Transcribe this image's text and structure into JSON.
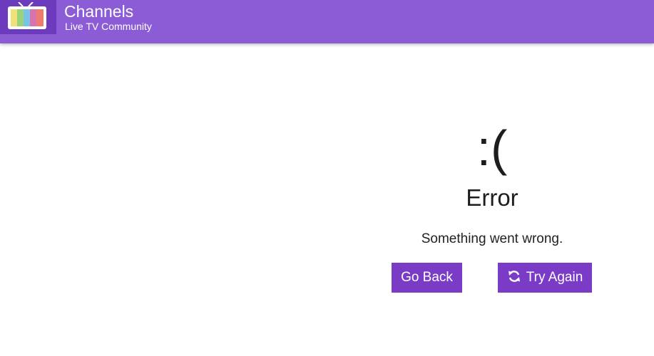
{
  "header": {
    "title": "Channels",
    "subtitle": "Live TV Community",
    "logo_icon": "tv-icon",
    "colors": {
      "bar": "#8b5cd6",
      "logo_bg": "#6c3bbd"
    }
  },
  "error": {
    "face": ":(",
    "title": "Error",
    "message": "Something went wrong."
  },
  "actions": {
    "go_back_label": "Go Back",
    "try_again_label": "Try Again",
    "try_again_icon": "refresh-icon",
    "button_color": "#7a3cc7"
  }
}
